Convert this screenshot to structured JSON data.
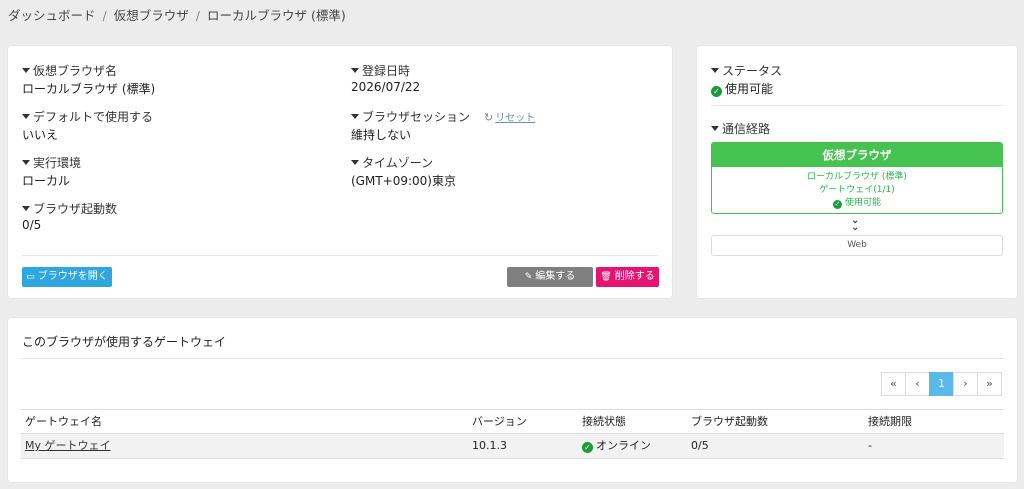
{
  "breadcrumb": [
    "ダッシュボード",
    "仮想ブラウザ",
    "ローカルブラウザ (標準)"
  ],
  "detail": {
    "name_label": "仮想ブラウザ名",
    "name_value": "ローカルブラウザ (標準)",
    "date_label": "登録日時",
    "date_value": "2026/07/22",
    "default_label": "デフォルトで使用する",
    "default_value": "いいえ",
    "session_label": "ブラウザセッション",
    "reset_label": "リセット",
    "session_value": "維持しない",
    "env_label": "実行環境",
    "env_value": "ローカル",
    "tz_label": "タイムゾーン",
    "tz_value": "(GMT+09:00)東京",
    "count_label": "ブラウザ起動数",
    "count_value": "0/5",
    "open_button": "ブラウザを開く",
    "edit_button": "編集する",
    "delete_button": "削除する"
  },
  "status": {
    "status_label": "ステータス",
    "status_value": "使用可能",
    "route_label": "通信経路",
    "route_head": "仮想ブラウザ",
    "route_line1": "ローカルブラウザ (標準)",
    "route_line2": "ゲートウェイ(1/1)",
    "route_line3": "使用可能",
    "route_web": "Web"
  },
  "gateways": {
    "title": "このブラウザが使用するゲートウェイ",
    "pager": [
      "«",
      "‹",
      "1",
      "›",
      "»"
    ],
    "columns": [
      "ゲートウェイ名",
      "バージョン",
      "接続状態",
      "ブラウザ起動数",
      "接続期限"
    ],
    "rows": [
      {
        "name": "My ゲートウェイ",
        "version": "10.1.3",
        "state": "オンライン",
        "count": "0/5",
        "limit": "-"
      }
    ]
  },
  "colors": {
    "accent": "#2fa6df",
    "success": "#46c250",
    "danger": "#e6136f",
    "neutral": "#808080"
  }
}
